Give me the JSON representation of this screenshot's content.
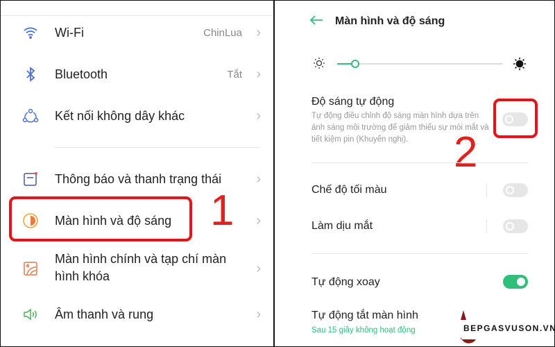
{
  "left": {
    "items": [
      {
        "label": "Wi-Fi",
        "value": "ChinLua",
        "icon": "wifi-icon"
      },
      {
        "label": "Bluetooth",
        "value": "Tắt",
        "icon": "bluetooth-icon"
      },
      {
        "label": "Kết nối không dây khác",
        "icon": "connections-icon"
      },
      {
        "label": "Thông báo và thanh trạng thái",
        "icon": "notification-icon"
      },
      {
        "label": "Màn hình và độ sáng",
        "icon": "brightness-icon"
      },
      {
        "label": "Màn hình chính và tạp chí màn hình khóa",
        "icon": "wallpaper-icon"
      },
      {
        "label": "Âm thanh và rung",
        "icon": "speaker-icon"
      }
    ],
    "step_label": "1"
  },
  "right": {
    "title": "Màn hình và độ sáng",
    "brightness_percent": 11,
    "auto_brightness": {
      "title": "Độ sáng tự động",
      "desc": "Tự động điều chỉnh độ sáng màn hình dựa trên ánh sáng môi trường để giảm thiểu sự mỏi mắt và tiết kiệm pin (Khuyến nghị).",
      "on": false
    },
    "dark_mode": {
      "title": "Chế độ tối màu",
      "on": false
    },
    "eye_comfort": {
      "title": "Làm dịu mắt",
      "on": false
    },
    "auto_rotate": {
      "title": "Tự động xoay",
      "on": true
    },
    "screen_timeout": {
      "title": "Tự động tắt màn hình",
      "value": "Sau 15 giây không hoạt động"
    },
    "step_label": "2"
  },
  "watermark": "BEPGASVUSON.VN",
  "colors": {
    "accent": "#2fbf7a",
    "highlight": "#e8121b"
  }
}
